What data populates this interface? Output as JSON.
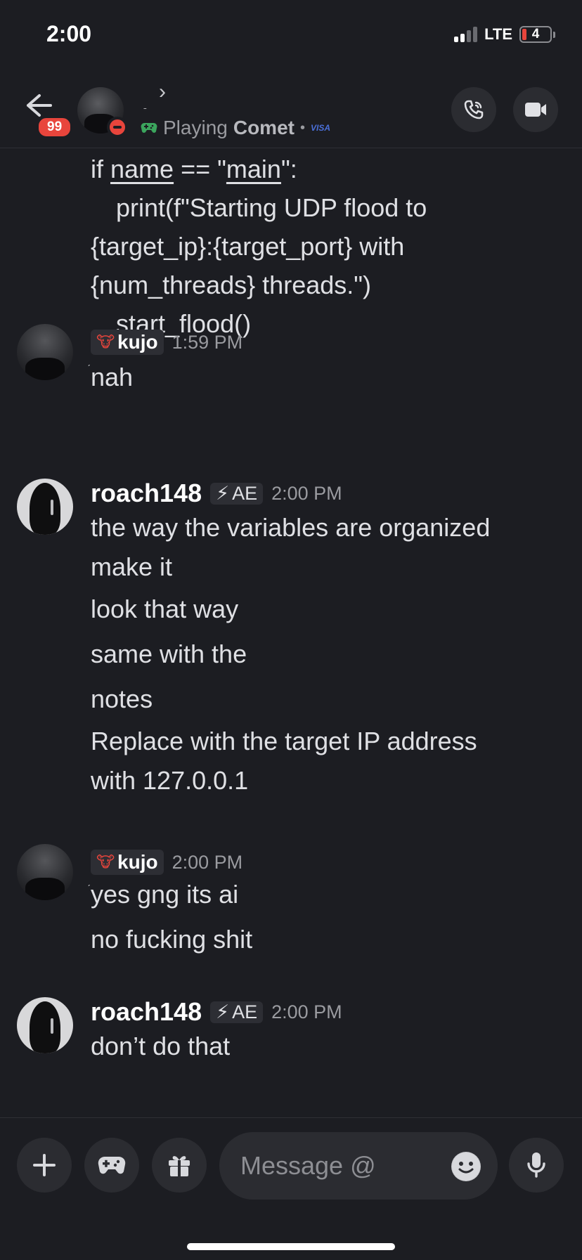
{
  "status_bar": {
    "time": "2:00",
    "network": "LTE",
    "battery": "4"
  },
  "header": {
    "unread_badge": "99",
    "chevron": "›",
    "name_mark": "ˍ",
    "activity_prefix": "Playing",
    "activity_game": "Comet",
    "activity_separator": "•",
    "activity_extra": "VISA"
  },
  "code_block": {
    "line1_a": "if ",
    "line1_name": "name",
    "line1_b": " == \"",
    "line1_main": "main",
    "line1_c": "\":",
    "line2": "print(f\"Starting UDP flood to",
    "line3": "{target_ip}:{target_port} with",
    "line4": "{num_threads} threads.\")",
    "line5": "start_flood()"
  },
  "messages": [
    {
      "author": "kujo",
      "role_emoji": "🐮",
      "timestamp": "1:59 PM",
      "lines": [
        "nah"
      ]
    },
    {
      "author": "roach148",
      "tag": "AE",
      "tag_icon": "⚡",
      "timestamp": "2:00 PM",
      "lines": [
        "the way the variables are organized",
        "make it",
        "look that way",
        "same with the",
        "notes",
        "Replace with the target IP address",
        "with 127.0.0.1"
      ]
    },
    {
      "author": "kujo",
      "role_emoji": "🐮",
      "timestamp": "2:00 PM",
      "lines": [
        "yes gng its ai",
        "no fucking shit"
      ]
    },
    {
      "author": "roach148",
      "tag": "AE",
      "tag_icon": "⚡",
      "timestamp": "2:00 PM",
      "lines": [
        "don’t do that"
      ]
    }
  ],
  "input": {
    "placeholder": "Message @"
  },
  "colors": {
    "background": "#1c1d22",
    "accent_red": "#e8453c",
    "button_bg": "#2b2c31",
    "activity_green": "#3ba55d"
  }
}
